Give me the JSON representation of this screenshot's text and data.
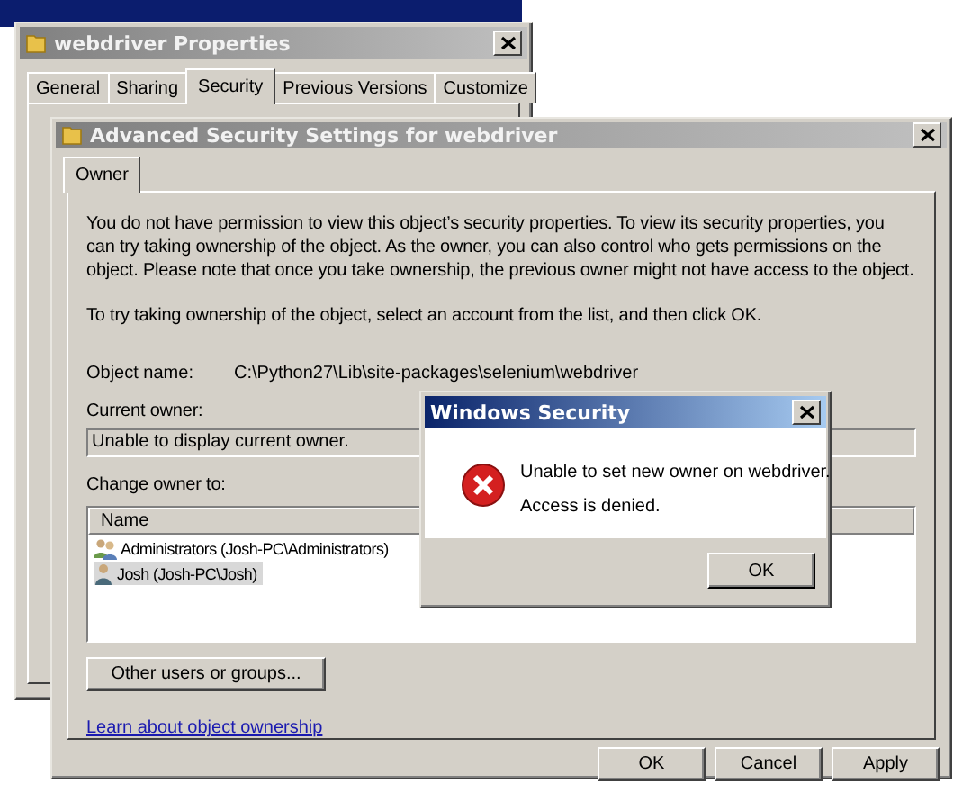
{
  "properties_window": {
    "title": "webdriver Properties",
    "tabs": [
      {
        "label": "General",
        "selected": false
      },
      {
        "label": "Sharing",
        "selected": false
      },
      {
        "label": "Security",
        "selected": true
      },
      {
        "label": "Previous Versions",
        "selected": false
      },
      {
        "label": "Customize",
        "selected": false
      }
    ]
  },
  "advanced_window": {
    "title": "Advanced Security Settings for webdriver",
    "tabs": [
      {
        "label": "Owner",
        "selected": true
      }
    ],
    "intro": "You do not have permission to view this object’s security properties. To view its security properties, you can try taking ownership of the object. As the owner, you can also control who gets permissions on the object. Please note that once you take ownership, the previous owner might not have access to the object.",
    "instruction": "To try taking ownership of the object, select an account from the list, and then click OK.",
    "object_name_label": "Object name:",
    "object_name": "C:\\Python27\\Lib\\site-packages\\selenium\\webdriver",
    "current_owner_label": "Current owner:",
    "current_owner": "Unable to display current owner.",
    "change_owner_label": "Change owner to:",
    "owner_list": {
      "columns": [
        "Name"
      ],
      "rows": [
        {
          "name": "Administrators (Josh-PC\\Administrators)",
          "kind": "group",
          "selected": false
        },
        {
          "name": "Josh (Josh-PC\\Josh)",
          "kind": "user",
          "selected": true
        }
      ]
    },
    "other_users_button": "Other users or groups...",
    "link": "Learn about object ownership",
    "buttons": [
      "OK",
      "Cancel",
      "Apply"
    ]
  },
  "error_dialog": {
    "title": "Windows Security",
    "message": "Unable to set new owner on webdriver.",
    "detail": "Access is denied.",
    "buttons": [
      "OK"
    ]
  }
}
